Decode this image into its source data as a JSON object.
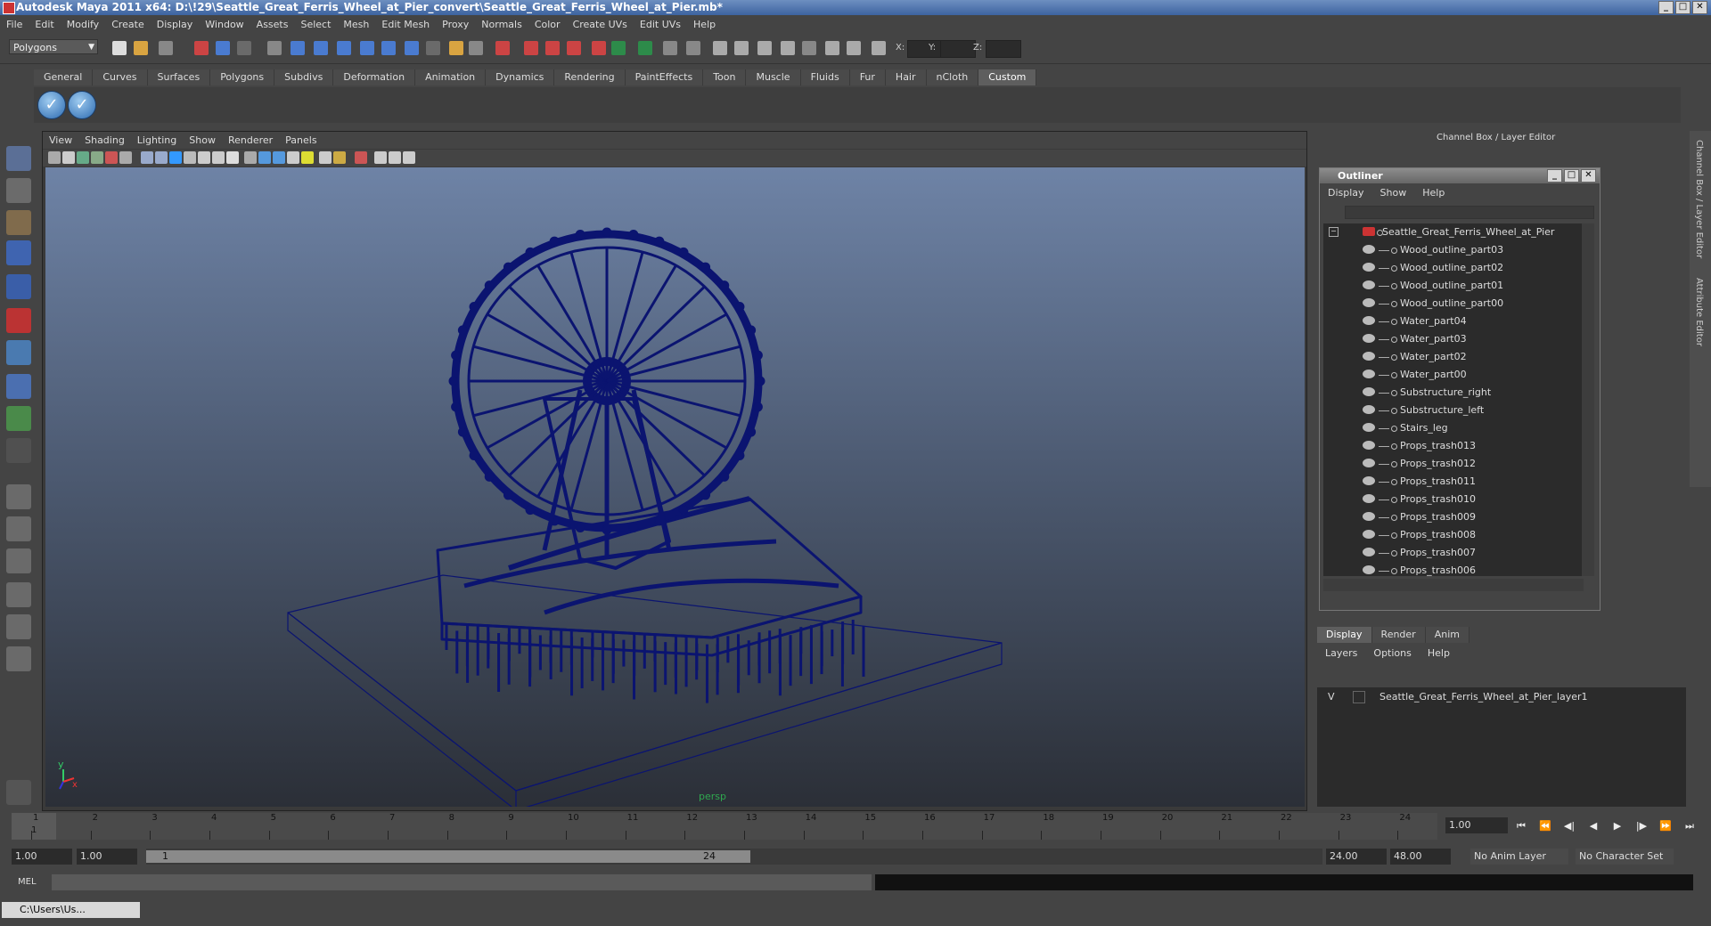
{
  "window": {
    "title": "Autodesk Maya 2011 x64: D:\\!29\\Seattle_Great_Ferris_Wheel_at_Pier_convert\\Seattle_Great_Ferris_Wheel_at_Pier.mb*"
  },
  "menubar": [
    "File",
    "Edit",
    "Modify",
    "Create",
    "Display",
    "Window",
    "Assets",
    "Select",
    "Mesh",
    "Edit Mesh",
    "Proxy",
    "Normals",
    "Color",
    "Create UVs",
    "Edit UVs",
    "Help"
  ],
  "status": {
    "mode": "Polygons",
    "x_label": "X:",
    "y_label": "Y:",
    "z_label": "Z:"
  },
  "shelf": {
    "tabs": [
      "General",
      "Curves",
      "Surfaces",
      "Polygons",
      "Subdivs",
      "Deformation",
      "Animation",
      "Dynamics",
      "Rendering",
      "PaintEffects",
      "Toon",
      "Muscle",
      "Fluids",
      "Fur",
      "Hair",
      "nCloth",
      "Custom"
    ],
    "active_tab": "Custom"
  },
  "viewport": {
    "menu": [
      "View",
      "Shading",
      "Lighting",
      "Show",
      "Renderer",
      "Panels"
    ],
    "camera": "persp",
    "axis_x": "x",
    "axis_y": "y",
    "wire_color": "#0b1470"
  },
  "channel_box": {
    "title": "Channel Box / Layer Editor",
    "side_tabs": [
      "Channel Box / Layer Editor",
      "Attribute Editor"
    ]
  },
  "outliner": {
    "title": "Outliner",
    "menu": [
      "Display",
      "Show",
      "Help"
    ],
    "root": "Seattle_Great_Ferris_Wheel_at_Pier",
    "items": [
      "Wood_outline_part03",
      "Wood_outline_part02",
      "Wood_outline_part01",
      "Wood_outline_part00",
      "Water_part04",
      "Water_part03",
      "Water_part02",
      "Water_part00",
      "Substructure_right",
      "Substructure_left",
      "Stairs_leg",
      "Props_trash013",
      "Props_trash012",
      "Props_trash011",
      "Props_trash010",
      "Props_trash009",
      "Props_trash008",
      "Props_trash007",
      "Props_trash006"
    ]
  },
  "layer_editor": {
    "tabs": [
      "Display",
      "Render",
      "Anim"
    ],
    "active_tab": "Display",
    "menu": [
      "Layers",
      "Options",
      "Help"
    ],
    "layers": [
      {
        "visible": "V",
        "name": "Seattle_Great_Ferris_Wheel_at_Pier_layer1"
      }
    ]
  },
  "timeline": {
    "ticks": [
      "1",
      "2",
      "3",
      "4",
      "5",
      "6",
      "7",
      "8",
      "9",
      "10",
      "11",
      "12",
      "13",
      "14",
      "15",
      "16",
      "17",
      "18",
      "19",
      "20",
      "21",
      "22",
      "23",
      "24"
    ],
    "current_frame": "1.00",
    "current_frame_marker": "1"
  },
  "range": {
    "start": "1.00",
    "start_inner": "1.00",
    "bar_start": "1",
    "bar_end": "24",
    "end_inner": "24.00",
    "end": "48.00",
    "anim_layer": "No Anim Layer",
    "character_set": "No Character Set"
  },
  "command_line": {
    "label": "MEL"
  },
  "taskbar": {
    "item": "C:\\Users\\Us..."
  }
}
